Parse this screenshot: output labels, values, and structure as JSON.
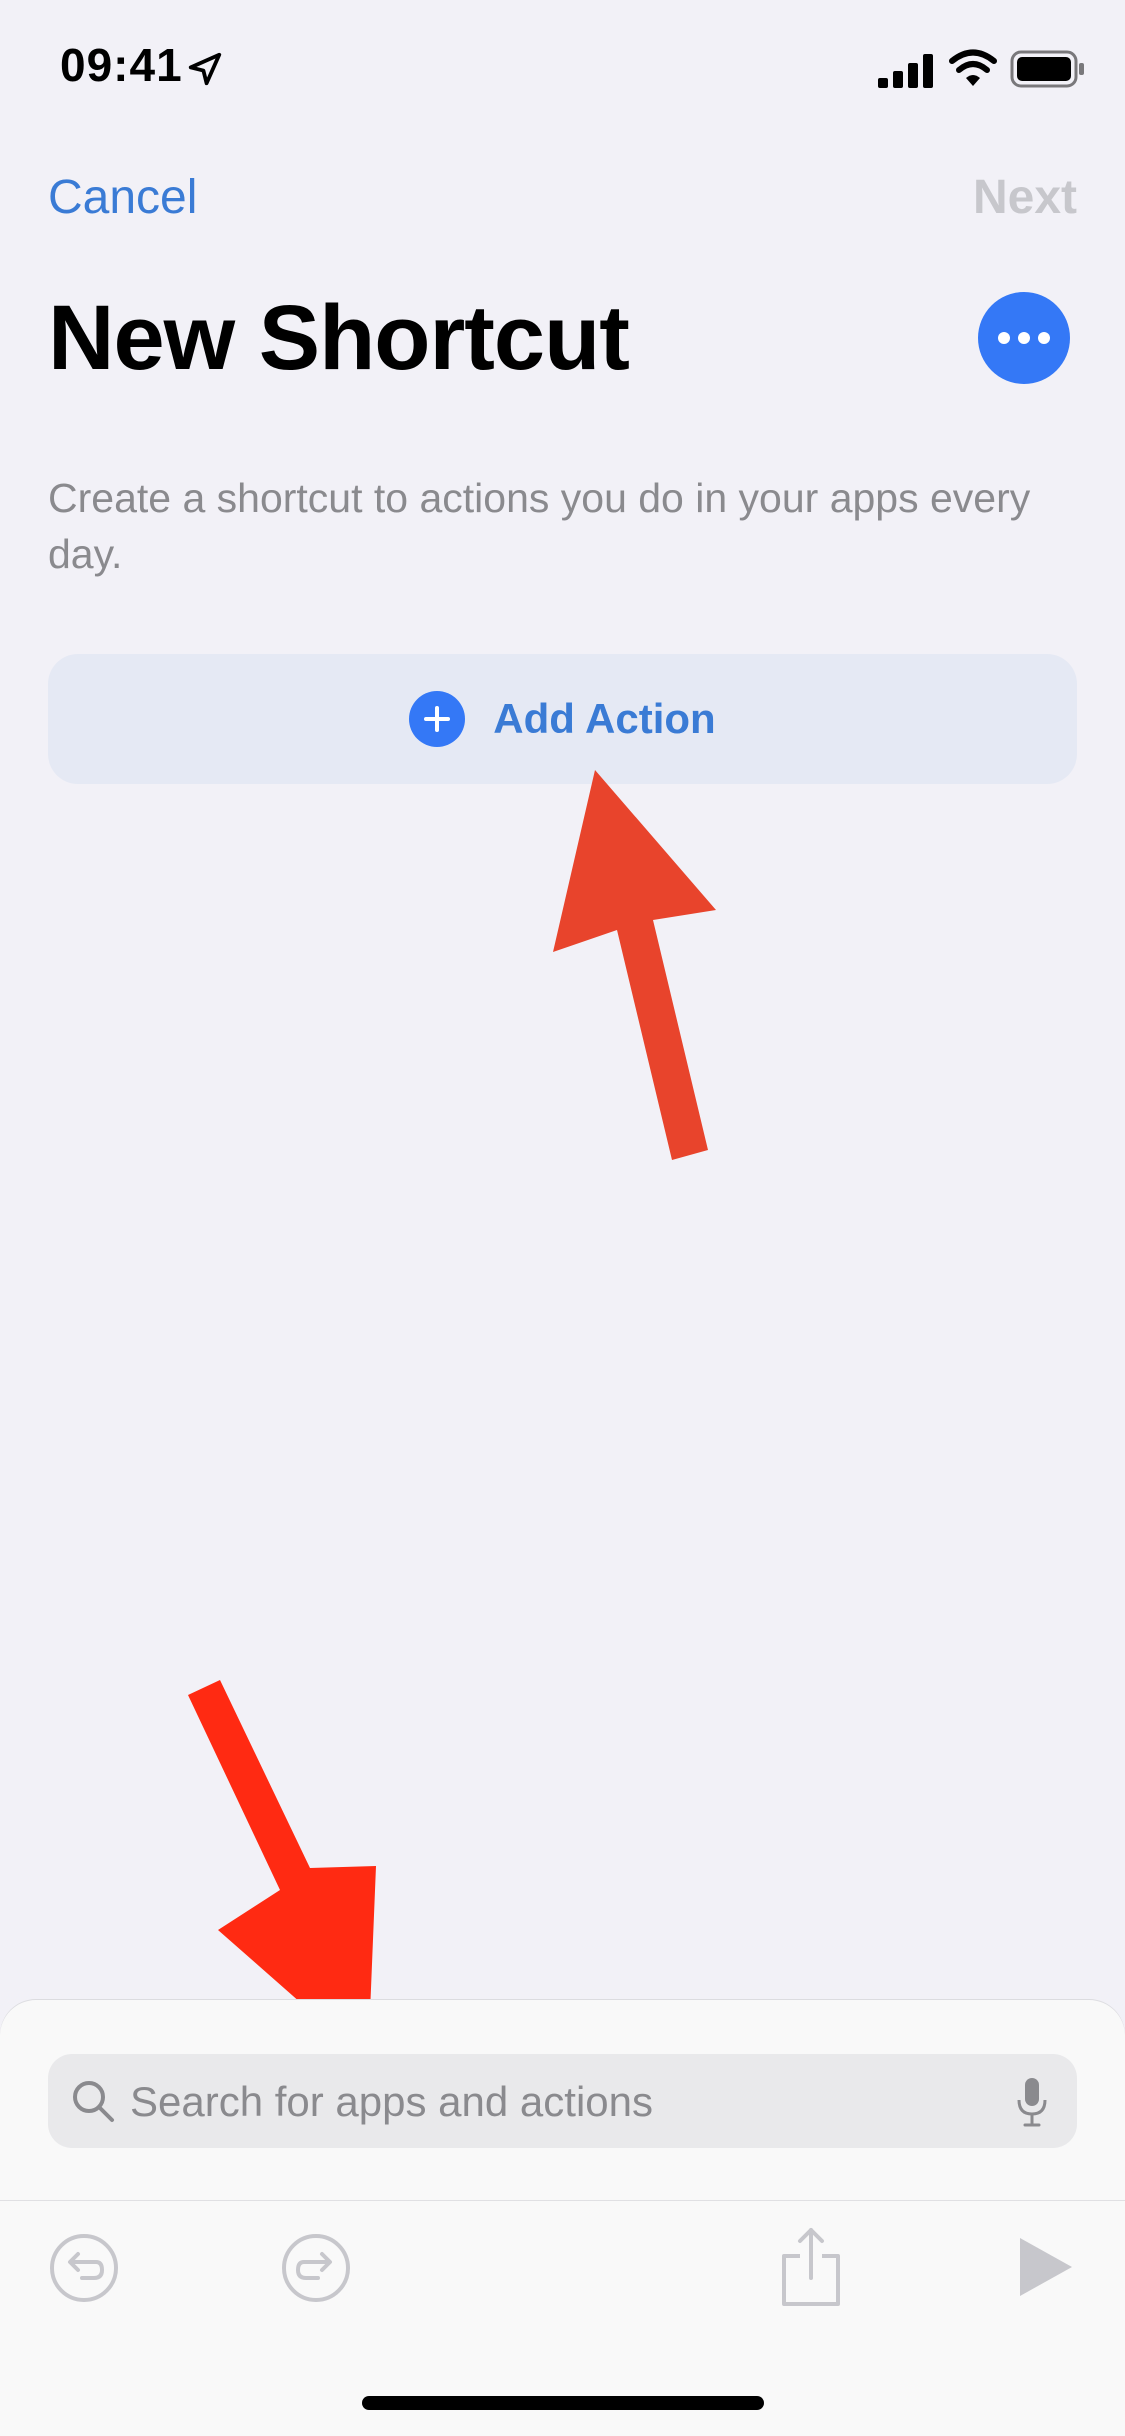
{
  "status_bar": {
    "time": "09:41",
    "icons": [
      "location-arrow-icon",
      "cellular-signal-icon",
      "wifi-icon",
      "battery-icon"
    ]
  },
  "nav": {
    "cancel_label": "Cancel",
    "next_label": "Next"
  },
  "header": {
    "title": "New Shortcut",
    "more_icon": "ellipsis-icon"
  },
  "description": "Create a shortcut to actions you do in your apps every day.",
  "add_action": {
    "label": "Add Action",
    "icon": "plus-circle-icon"
  },
  "search": {
    "placeholder": "Search for apps and actions",
    "value": ""
  },
  "toolbar": {
    "icons": [
      "undo-icon",
      "redo-icon",
      "share-icon",
      "play-icon"
    ]
  },
  "colors": {
    "accent": "#3478f6",
    "link": "#3a7bd5",
    "background": "#f2f1f7",
    "annotation_arrow": "#e8442c"
  }
}
